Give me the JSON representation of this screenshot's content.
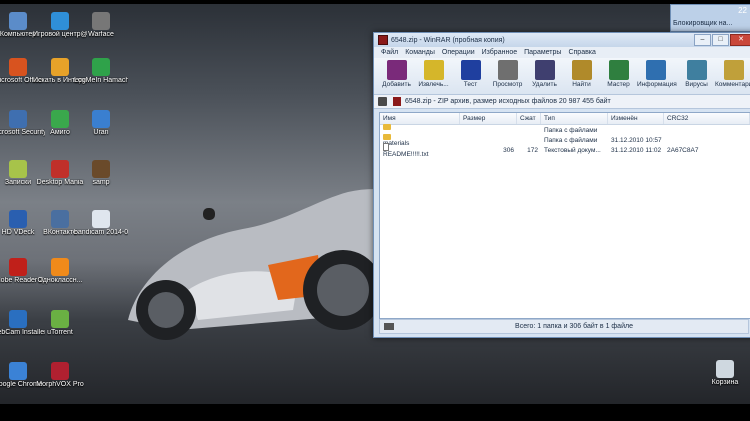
{
  "desktop_icons": [
    {
      "label": "Компьютер",
      "color": "#5b8cc9"
    },
    {
      "label": "Игровой центр@Ма...",
      "color": "#2f8fd8"
    },
    {
      "label": "Warface",
      "color": "#777777"
    },
    {
      "label": "Microsoft Office",
      "color": "#d8531f"
    },
    {
      "label": "Искать в Интернете",
      "color": "#e7a229"
    },
    {
      "label": "LogMeIn Hamachi",
      "color": "#2fa24a"
    },
    {
      "label": "Microsoft Security...",
      "color": "#3f6fb0"
    },
    {
      "label": "Амиго",
      "color": "#3aa84c"
    },
    {
      "label": "Uran",
      "color": "#3a7fd0"
    },
    {
      "label": "Записки",
      "color": "#a7c34a"
    },
    {
      "label": "Desktop Mania",
      "color": "#c0302a"
    },
    {
      "label": "samp",
      "color": "#6a4a2a"
    },
    {
      "label": "HD VDeck",
      "color": "#2a5fb0"
    },
    {
      "label": "ВКонтакте",
      "color": "#4a6fa0"
    },
    {
      "label": "bandicam 2014-08-22...",
      "color": "#dfe6ee"
    },
    {
      "label": "Adobe Reader X",
      "color": "#c0201a"
    },
    {
      "label": "Одноклассн...",
      "color": "#f08a1a"
    },
    {
      "label": "WebCam Installer 4.041",
      "color": "#2a6fc0"
    },
    {
      "label": "uTorrent",
      "color": "#6ab043"
    },
    {
      "label": "Google Chrome",
      "color": "#3b82d6"
    },
    {
      "label": "MorphVOX Pro",
      "color": "#b02030"
    },
    {
      "label": "Корзина",
      "color": "#cfd8e0"
    }
  ],
  "mini_window": {
    "title": "22",
    "body": "Блокировщик на..."
  },
  "winrar": {
    "title": "6548.zip - WinRAR (пробная копия)",
    "menu": [
      "Файл",
      "Команды",
      "Операции",
      "Избранное",
      "Параметры",
      "Справка"
    ],
    "toolbar": [
      {
        "label": "Добавить",
        "icon": "add-archive-icon",
        "color": "#7a2a7a"
      },
      {
        "label": "Извлечь...",
        "icon": "extract-icon",
        "color": "#d5b62a"
      },
      {
        "label": "Тест",
        "icon": "test-icon",
        "color": "#1f3f9f"
      },
      {
        "label": "Просмотр",
        "icon": "view-icon",
        "color": "#6f6f6f"
      },
      {
        "label": "Удалить",
        "icon": "delete-icon",
        "color": "#3f3f6f"
      },
      {
        "label": "Найти",
        "icon": "find-icon",
        "color": "#b08a2a"
      },
      {
        "label": "Мастер",
        "icon": "wizard-icon",
        "color": "#2f7f3f"
      },
      {
        "label": "Информация",
        "icon": "info-icon",
        "color": "#2f6fb0"
      },
      {
        "label": "Вирусы",
        "icon": "virus-scan-icon",
        "color": "#3f7f9f"
      },
      {
        "label": "Комментарий",
        "icon": "comment-icon",
        "color": "#c0a03a"
      }
    ],
    "path_text": "6548.zip - ZIP архив, размер исходных файлов 20 987 455 байт",
    "columns": [
      "Имя",
      "Размер",
      "Сжат",
      "Тип",
      "Изменён",
      "CRC32"
    ],
    "rows": [
      {
        "name": "..",
        "size": "",
        "packed": "",
        "type": "Папка с файлами",
        "modified": "",
        "crc": "",
        "kind": "folder"
      },
      {
        "name": "materials",
        "size": "",
        "packed": "",
        "type": "Папка с файлами",
        "modified": "31.12.2010 10:57",
        "crc": "",
        "kind": "folder"
      },
      {
        "name": "README!!!!!.txt",
        "size": "306",
        "packed": "172",
        "type": "Текстовый докум...",
        "modified": "31.12.2010 11:02",
        "crc": "2A67C8A7",
        "kind": "file"
      }
    ],
    "status": "Всего: 1 папка и 306 байт в 1 файле"
  }
}
